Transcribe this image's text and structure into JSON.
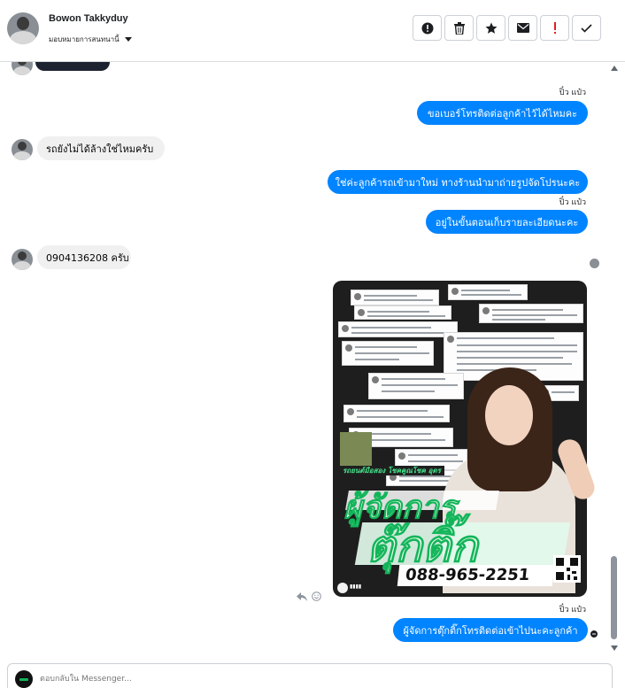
{
  "header": {
    "contact_name": "Bowon Takkyduy",
    "assign_label": "มอบหมายการสนทนานี้",
    "actions": [
      {
        "name": "report-spam-button",
        "icon": "alert-circle-icon"
      },
      {
        "name": "delete-button",
        "icon": "trash-icon"
      },
      {
        "name": "star-button",
        "icon": "star-icon"
      },
      {
        "name": "mark-unread-button",
        "icon": "envelope-icon"
      },
      {
        "name": "follow-up-button",
        "icon": "exclamation-icon"
      },
      {
        "name": "mark-done-button",
        "icon": "check-icon"
      }
    ]
  },
  "messages": [
    {
      "direction": "out",
      "sender": "ปิ๋ว แป๋ว",
      "text": "ขอเบอร์โทรติดต่อลูกค้าไว้ได้ไหมคะ"
    },
    {
      "direction": "in",
      "text": "รถยังไม่ได้ล้างใช่ไหมครับ"
    },
    {
      "direction": "out",
      "text": "ใช่ค่ะลูกค้ารถเข้ามาใหม่ ทางร้านนำมาถ่ายรูปจัดโปรนะคะ"
    },
    {
      "direction": "out",
      "sender": "ปิ๋ว แป๋ว",
      "text": "อยู่ในขั้นตอนเก็บรายละเอียดนะคะ"
    },
    {
      "direction": "in",
      "text": "0904136208 ครับ"
    },
    {
      "direction": "out",
      "type": "image",
      "image_text": {
        "subtitle": "รถยนต์มือสอง โชคคูณโชค อุดร",
        "title_small": "ผู้จัดการ",
        "title_big": "ตุ๊กติ๊ก",
        "phone": "088-965-2251"
      }
    },
    {
      "direction": "out",
      "sender": "ปิ๋ว แป๋ว",
      "text": "ผู้จัดการตุ๊กติ๊กโทรติดต่อเข้าไปนะคะลูกค้า"
    }
  ],
  "composer": {
    "placeholder": "ตอบกลับใน Messenger..."
  },
  "colors": {
    "outgoing_bubble": "#0084ff",
    "incoming_bubble": "#f0f0f0",
    "brand_green": "#13b55a"
  }
}
